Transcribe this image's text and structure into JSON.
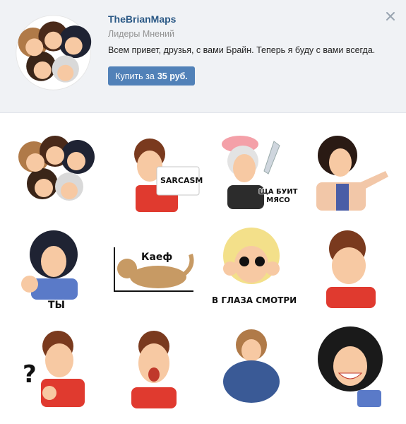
{
  "pack": {
    "title": "TheBrianMaps",
    "author": "Лидеры Мнений",
    "description": "Всем привет, друзья, с вами Брайн. Теперь я буду с вами всегда.",
    "buy_prefix": "Купить за",
    "buy_price": "35 руб."
  },
  "stickers": [
    {
      "caption": ""
    },
    {
      "caption": "SARCASM"
    },
    {
      "caption": "ЩА БУИТ МЯСО"
    },
    {
      "caption": ""
    },
    {
      "caption": "ТЫ"
    },
    {
      "caption": "Каеф"
    },
    {
      "caption": "В ГЛАЗА СМОТРИ"
    },
    {
      "caption": ""
    },
    {
      "caption": "?"
    },
    {
      "caption": ""
    },
    {
      "caption": ""
    },
    {
      "caption": ""
    }
  ],
  "colors": {
    "header_bg": "#f0f2f5",
    "title": "#2a5885",
    "button": "#5181b8",
    "muted": "#939393"
  }
}
